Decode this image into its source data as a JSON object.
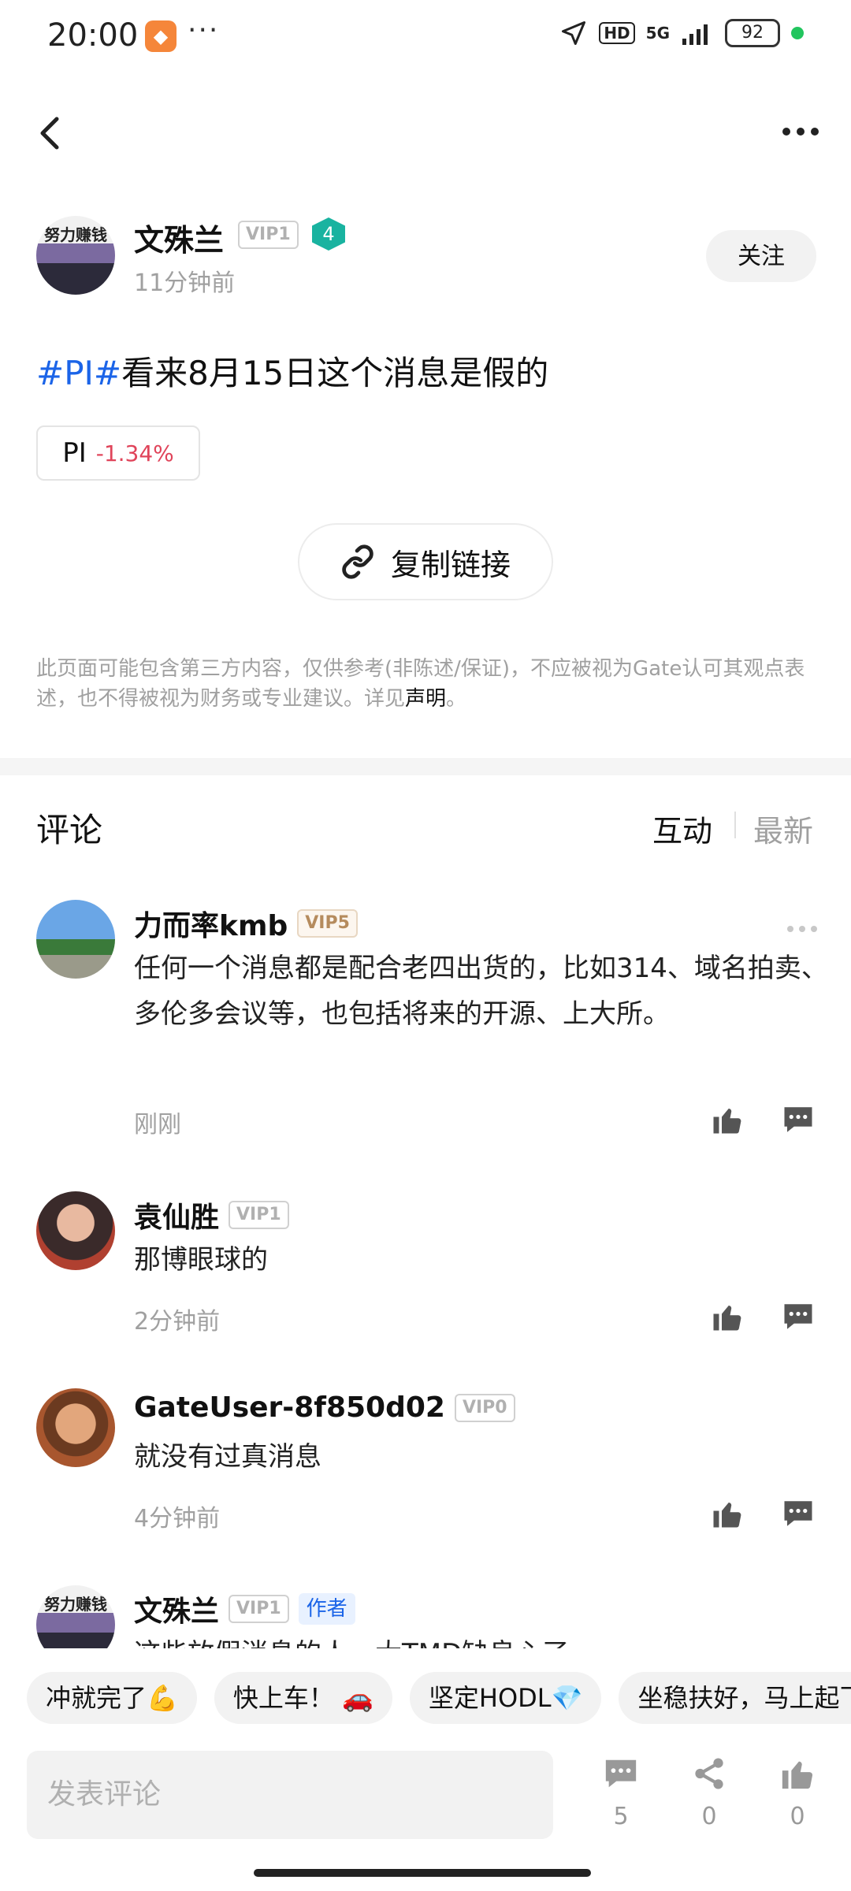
{
  "status_bar": {
    "time": "20:00",
    "dots": "···",
    "network": "5G",
    "hd": "HD",
    "battery": "92"
  },
  "post": {
    "author": {
      "name": "文殊兰",
      "vip": "VIP1",
      "level": "4",
      "time": "11分钟前",
      "avatar_text": "努力赚钱"
    },
    "follow_label": "关注",
    "tag": "#PI#",
    "text": "看来8月15日这个消息是假的",
    "coin": {
      "name": "PI",
      "change": "-1.34%"
    },
    "copy_link_label": "复制链接",
    "disclaimer": "此页面可能包含第三方内容，仅供参考(非陈述/保证)，不应被视为Gate认可其观点表述，也不得被视为财务或专业建议。详见",
    "disclaimer_link": "声明",
    "disclaimer_end": "。"
  },
  "comments": {
    "title": "评论",
    "sort_active": "互动",
    "sort_other": "最新",
    "items": [
      {
        "name": "力而率kmb",
        "vip": "VIP5",
        "text": "任何一个消息都是配合老四出货的，比如314、域名拍卖、多伦多会议等，也包括将来的开源、上大所。",
        "time": "刚刚"
      },
      {
        "name": "袁仙胜",
        "vip": "VIP1",
        "text": "那博眼球的",
        "time": "2分钟前"
      },
      {
        "name": "GateUser-8f850d02",
        "vip": "VIP0",
        "text": "就没有过真消息",
        "time": "4分钟前"
      },
      {
        "name": "文殊兰",
        "vip": "VIP1",
        "author_tag": "作者",
        "text": "这些放假消息的人，大TMD缺良心了",
        "avatar_text": "努力赚钱"
      }
    ]
  },
  "quick_replies": [
    "冲就完了💪",
    "快上车！ 🚗",
    "坚定HODL💎",
    "坐稳扶好，马上起飞"
  ],
  "bottom_bar": {
    "placeholder": "发表评论",
    "comment_count": "5",
    "share_count": "0",
    "like_count": "0"
  }
}
